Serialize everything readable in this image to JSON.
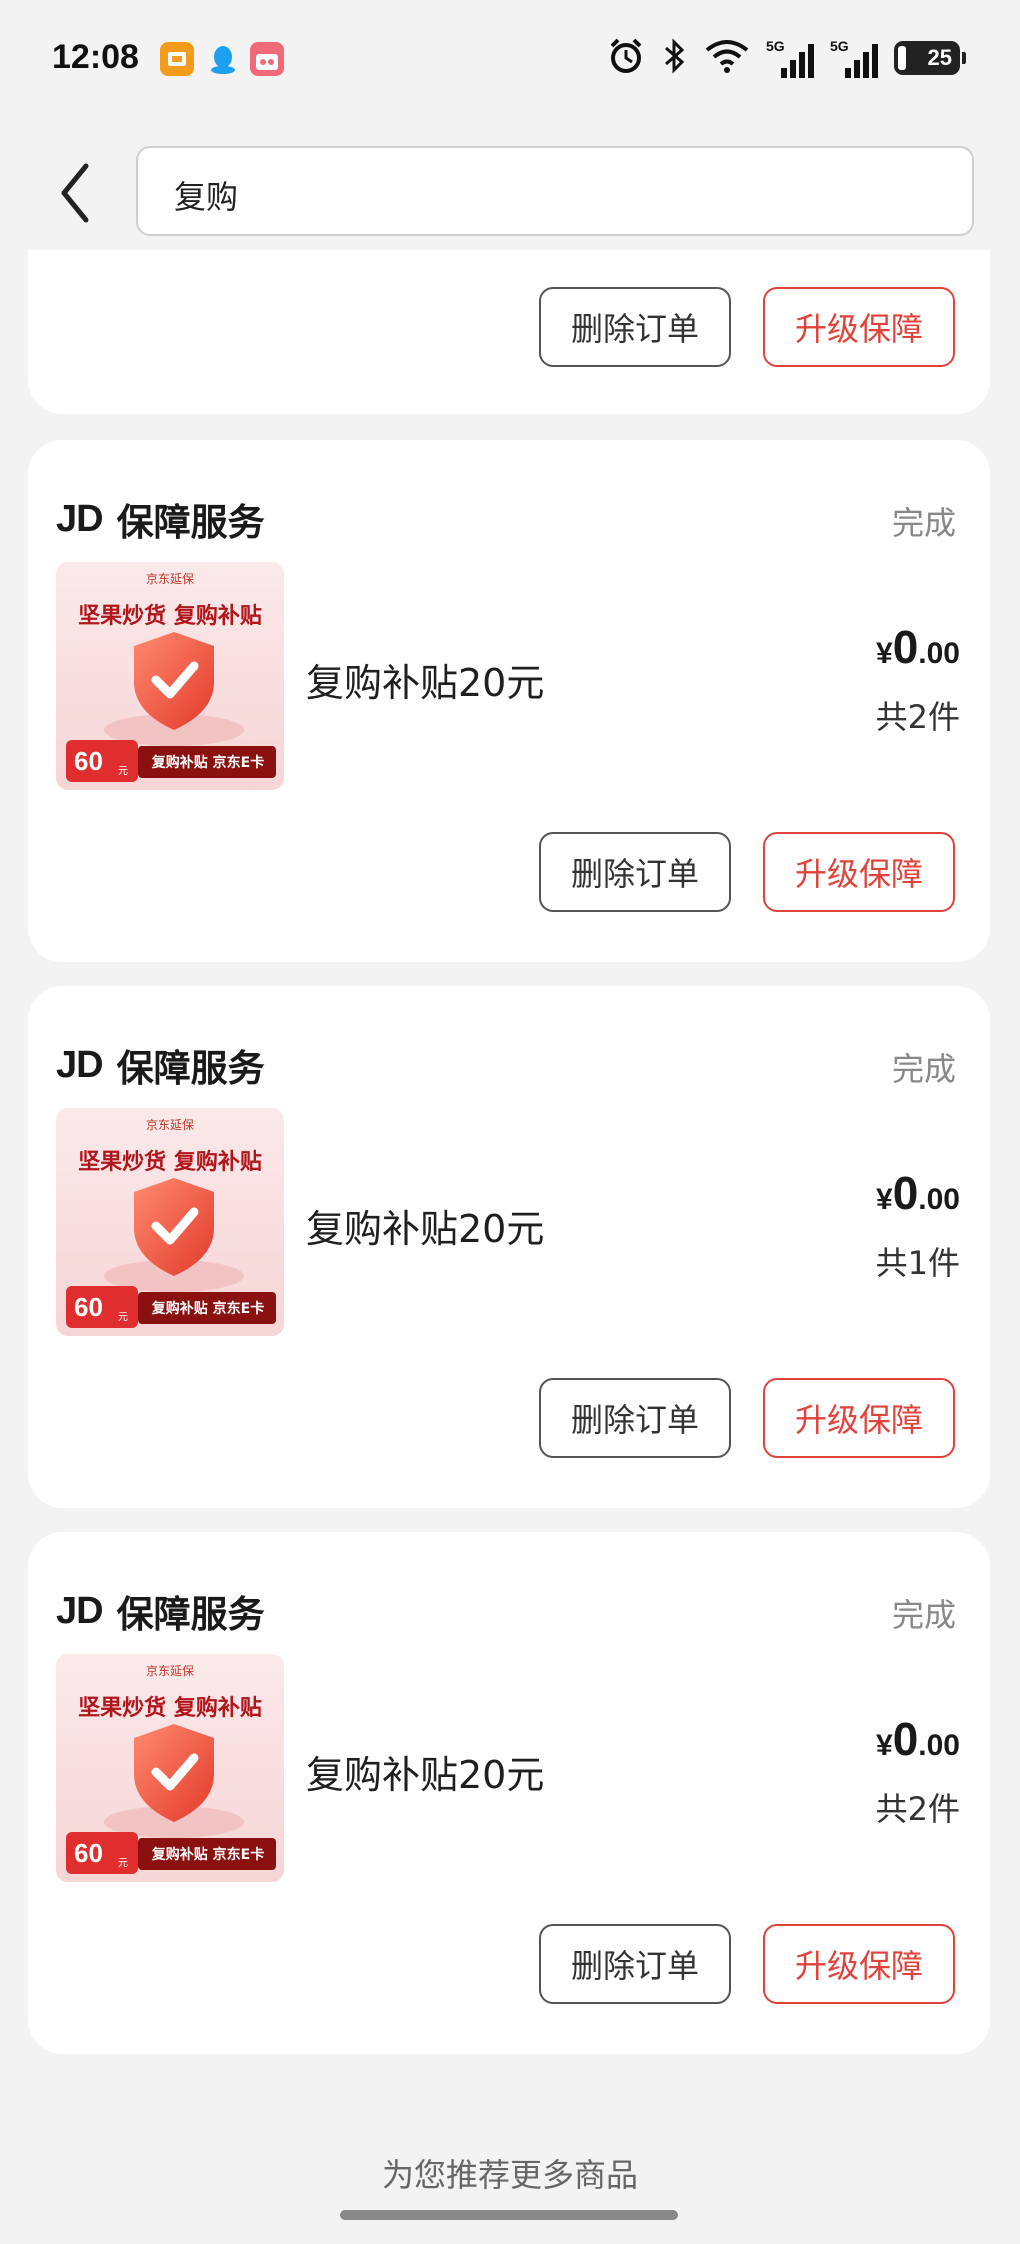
{
  "status_bar": {
    "time": "12:08",
    "network_left": "5G",
    "network_right": "5G",
    "battery": "25",
    "icons": [
      "alarm-icon",
      "bluetooth-icon",
      "wifi-icon"
    ]
  },
  "search": {
    "query": "复购"
  },
  "top_card": {
    "delete_label": "删除订单",
    "upgrade_label": "升级保障"
  },
  "orders": [
    {
      "jd": "JD",
      "shop": "保障服务",
      "status": "完成",
      "item": "复购补贴20元",
      "price_currency": "¥",
      "price_int": "0",
      "price_dec": ".00",
      "quantity": "共2件",
      "delete_label": "删除订单",
      "upgrade_label": "升级保障",
      "thumb": {
        "brand": "京东延保",
        "headline": "坚果炒货 复购补贴",
        "badge_value": "60",
        "badge_unit": "元",
        "footer": "复购补贴 京东E卡"
      }
    },
    {
      "jd": "JD",
      "shop": "保障服务",
      "status": "完成",
      "item": "复购补贴20元",
      "price_currency": "¥",
      "price_int": "0",
      "price_dec": ".00",
      "quantity": "共1件",
      "delete_label": "删除订单",
      "upgrade_label": "升级保障",
      "thumb": {
        "brand": "京东延保",
        "headline": "坚果炒货 复购补贴",
        "badge_value": "60",
        "badge_unit": "元",
        "footer": "复购补贴 京东E卡"
      }
    },
    {
      "jd": "JD",
      "shop": "保障服务",
      "status": "完成",
      "item": "复购补贴20元",
      "price_currency": "¥",
      "price_int": "0",
      "price_dec": ".00",
      "quantity": "共2件",
      "delete_label": "删除订单",
      "upgrade_label": "升级保障",
      "thumb": {
        "brand": "京东延保",
        "headline": "坚果炒货 复购补贴",
        "badge_value": "60",
        "badge_unit": "元",
        "footer": "复购补贴 京东E卡"
      }
    }
  ],
  "footer": {
    "recommend": "为您推荐更多商品"
  },
  "colors": {
    "accent": "#e0433a",
    "background": "#f3f3f3",
    "card": "#ffffff"
  }
}
